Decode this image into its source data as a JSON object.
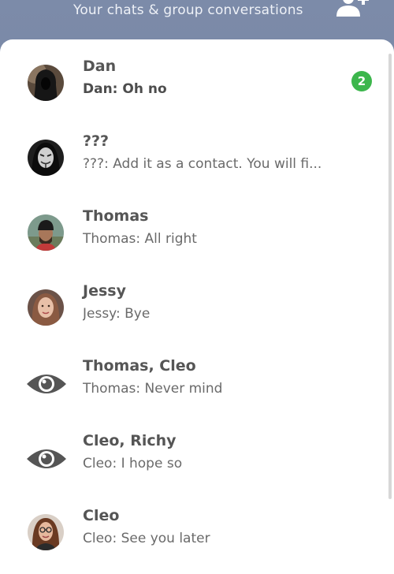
{
  "header": {
    "subtitle": "Your chats & group conversations",
    "add_contact_icon": "add-user-icon"
  },
  "colors": {
    "header_bg": "#7c8ba9",
    "badge": "#3cb64c",
    "name_text": "#555555",
    "preview_text": "#6a6a6a"
  },
  "chats": [
    {
      "name": "Dan",
      "preview": "Dan: Oh no",
      "unread": "2",
      "avatar": "hooded-person-photo"
    },
    {
      "name": "???",
      "preview": "???: Add it as a contact. You will fi...",
      "avatar": "mask-photo"
    },
    {
      "name": "Thomas",
      "preview": "Thomas: All right",
      "avatar": "man-beanie-photo"
    },
    {
      "name": "Jessy",
      "preview": "Jessy: Bye",
      "avatar": "woman-photo"
    },
    {
      "name": "Thomas, Cleo",
      "preview": "Thomas: Never mind",
      "avatar": "eye-icon"
    },
    {
      "name": "Cleo, Richy",
      "preview": "Cleo: I hope so",
      "avatar": "eye-icon"
    },
    {
      "name": "Cleo",
      "preview": "Cleo: See you later",
      "avatar": "woman-glasses-photo"
    }
  ]
}
